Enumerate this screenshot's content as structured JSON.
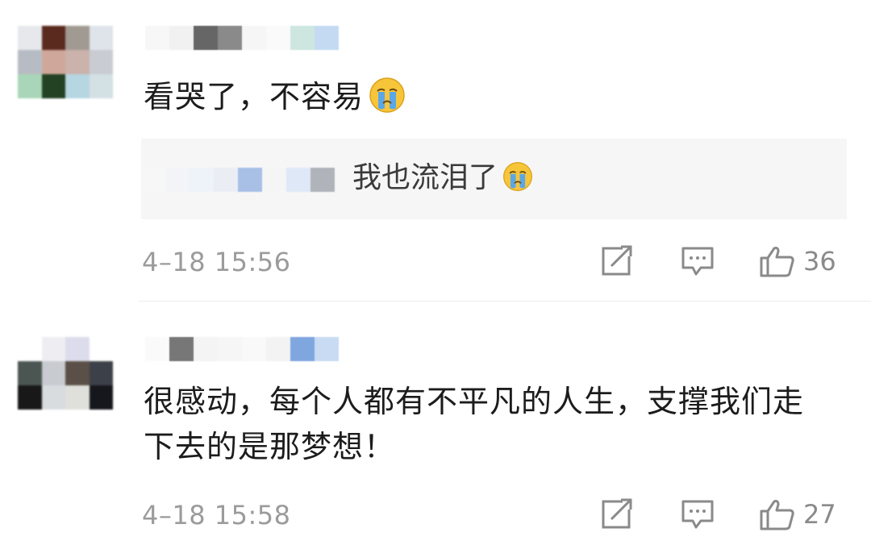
{
  "comments": [
    {
      "text": "看哭了，不容易",
      "emoji": "crying-face-emoji",
      "reply": {
        "text": "我也流泪了",
        "emoji": "crying-face-emoji"
      },
      "time": "4–18 15:56",
      "likes": "36"
    },
    {
      "text": "很感动，每个人都有不平凡的人生，支撑我们走下去的是那梦想！",
      "time": "4–18 15:58",
      "likes": "27"
    }
  ],
  "icons": {
    "share": "share-icon",
    "comment": "comment-icon",
    "like": "thumbs-up-icon"
  },
  "colors": {
    "meta_text": "#9b9b9b",
    "reply_bg": "#f6f6f6",
    "emoji_yellow": "#f7c53a",
    "tear_blue": "#5aa7e8"
  }
}
